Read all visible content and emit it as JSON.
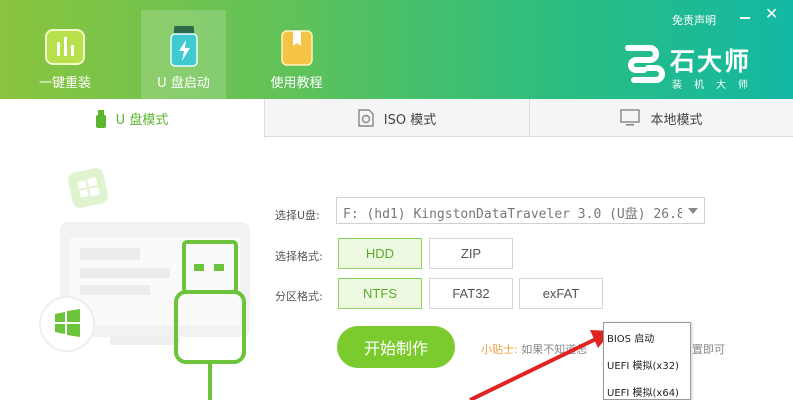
{
  "header": {
    "nav": [
      {
        "label": "一键重装",
        "icon": "chart-icon"
      },
      {
        "label": "U 盘启动",
        "icon": "usb-flash-icon"
      },
      {
        "label": "使用教程",
        "icon": "book-icon"
      }
    ],
    "disclaimer": "免责声明",
    "brand_name": "石大师",
    "brand_sub": "装机大师",
    "colors": {
      "gradient_start": "#8ac43f",
      "gradient_end": "#14b8a3"
    }
  },
  "tabs": [
    {
      "label": "U 盘模式",
      "icon": "usb-icon"
    },
    {
      "label": "ISO 模式",
      "icon": "iso-file-icon"
    },
    {
      "label": "本地模式",
      "icon": "monitor-icon"
    }
  ],
  "form": {
    "disk_label": "选择U盘:",
    "disk_value": "F: (hd1) KingstonDataTraveler 3.0 (U盘) 26.8",
    "format_label": "选择格式:",
    "format_options": [
      "HDD",
      "ZIP"
    ],
    "partition_label": "分区格式:",
    "partition_options": [
      "NTFS",
      "FAT32",
      "exFAT"
    ],
    "start_button": "开始制作",
    "tip_lead": "小贴士:",
    "tip_text": "如果不知道怎",
    "tip_tail": "置即可"
  },
  "popup": {
    "items": [
      "BIOS 启动",
      "UEFI 模拟(x32)",
      "UEFI 模拟(x64)"
    ]
  },
  "accent": "#7ccb2e"
}
